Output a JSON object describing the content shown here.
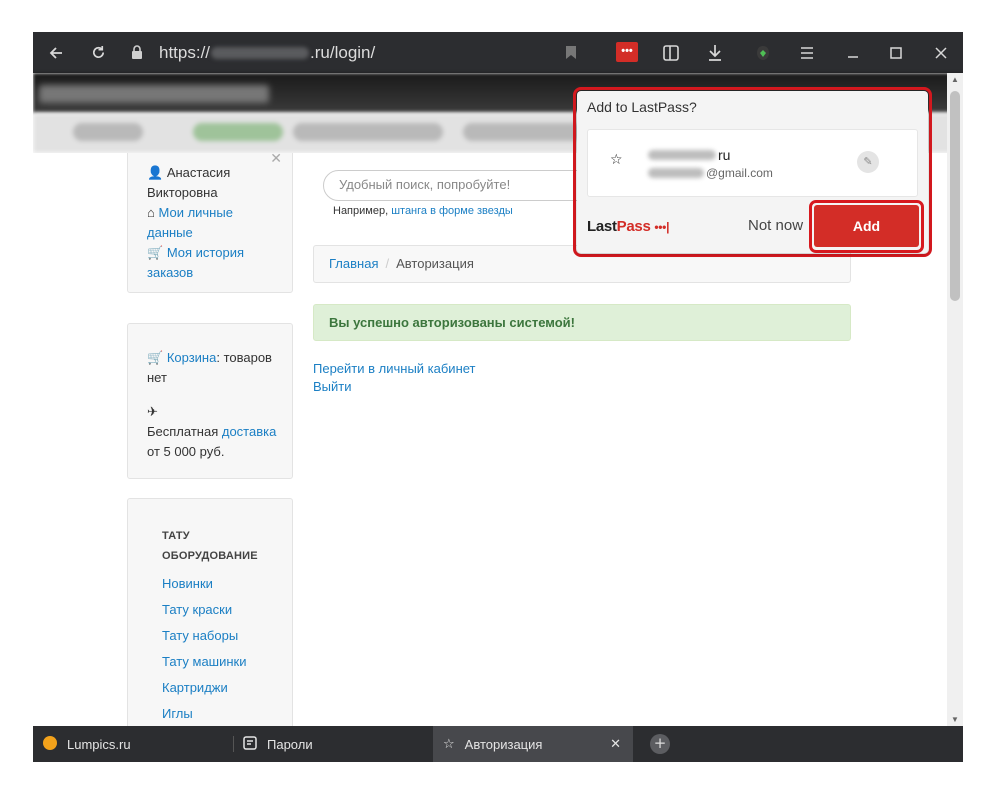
{
  "browser": {
    "url_prefix": "https://",
    "url_suffix": ".ru/login/",
    "icons": [
      "back-icon",
      "reload-icon",
      "lock-icon",
      "bookmark-icon",
      "lastpass-extension-icon",
      "reading-list-icon",
      "download-icon",
      "protect-icon",
      "menu-icon",
      "minimize-icon",
      "maximize-icon",
      "close-icon"
    ]
  },
  "sidebar": {
    "user_first": "Анастасия",
    "user_last": "Викторовна",
    "account_link_1": "Мои личные",
    "account_link_2": "данные",
    "orders_link_1": "Моя история",
    "orders_link_2": "заказов",
    "cart_link": "Корзина",
    "cart_text": ": товаров",
    "cart_text2": "нет",
    "delivery_pre": "Бесплатная",
    "delivery_link": "доставка",
    "delivery_post": "от 5 000 руб.",
    "category_head_1": "ТАТУ",
    "category_head_2": "ОБОРУДОВАНИЕ",
    "categories": [
      "Новинки",
      "Тату краски",
      "Тату наборы",
      "Тату машинки",
      "Картриджи",
      "Иглы"
    ]
  },
  "main": {
    "search_placeholder": "Удобный поиск, попробуйте!",
    "example_text": "Например,",
    "example_link": "штанга в форме звезды",
    "breadcrumb_home": "Главная",
    "breadcrumb_sep": "/",
    "breadcrumb_current": "Авторизация",
    "success_message": "Вы успешно авторизованы системой!",
    "cabinet_link": "Перейти в личный кабинет",
    "logout_link": "Выйти"
  },
  "lastpass": {
    "title": "Add to LastPass?",
    "site_suffix": "ru",
    "username_suffix": "@gmail.com",
    "logo_last": "Last",
    "logo_pass": "Pass",
    "logo_dots": "•••|",
    "not_now": "Not now",
    "add": "Add"
  },
  "tabs": [
    {
      "label": "Lumpics.ru"
    },
    {
      "label": "Пароли"
    },
    {
      "label": "Авторизация"
    }
  ],
  "colors": {
    "accent_red": "#d32d27",
    "link_blue": "#1b7fc4",
    "success_bg": "#dff0d8"
  }
}
